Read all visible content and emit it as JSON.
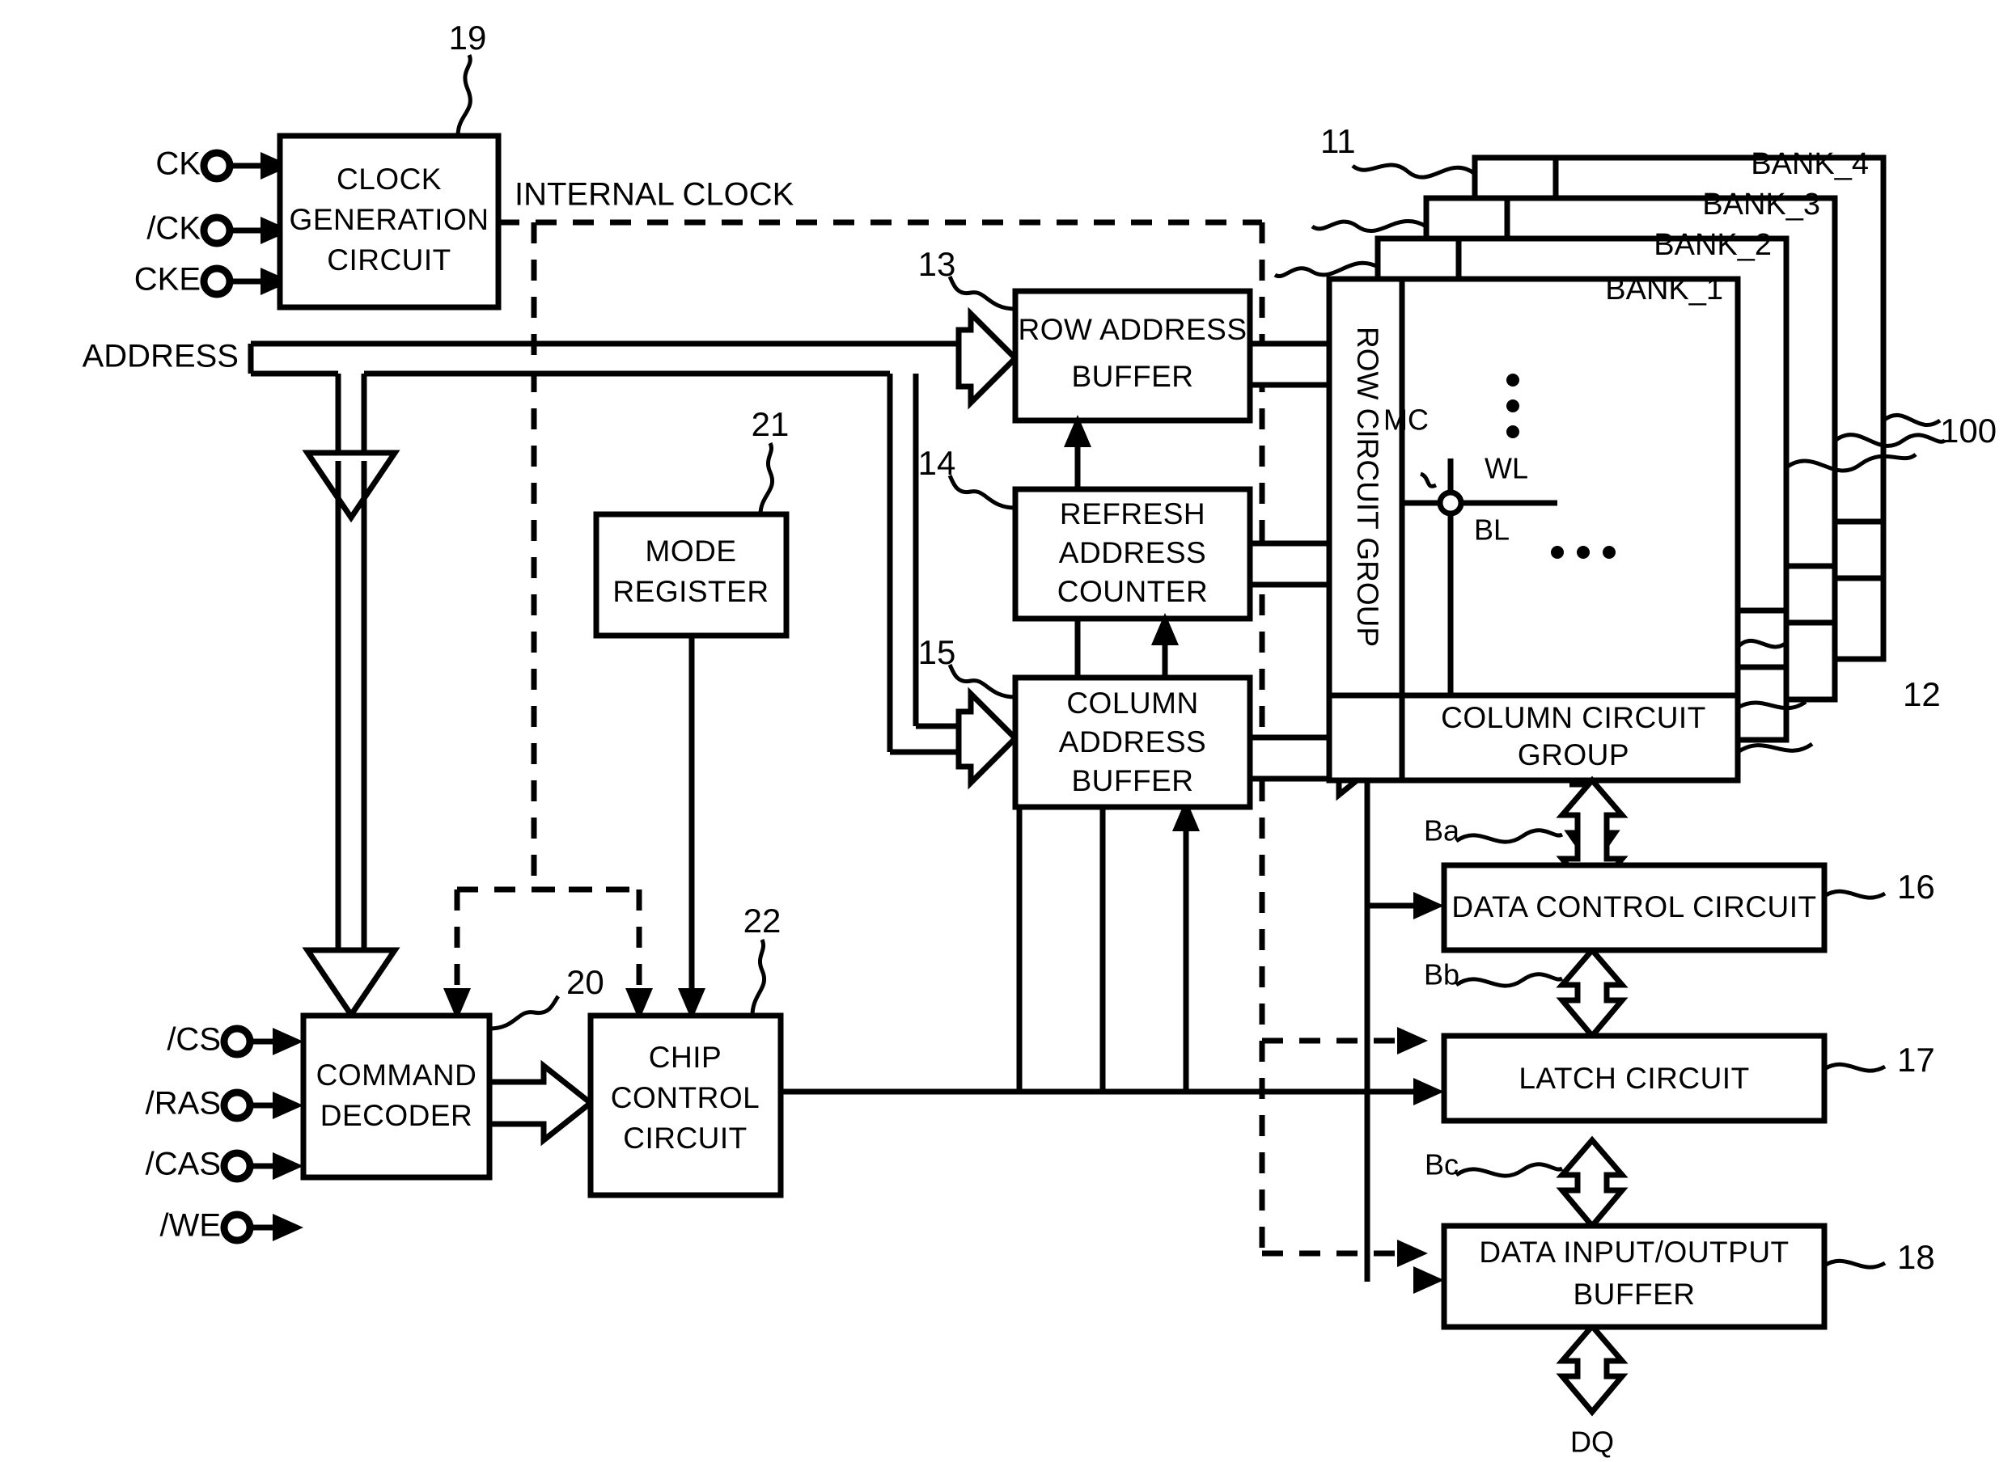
{
  "figure": {
    "type": "semiconductor-block-diagram",
    "title": "SDRAM device block diagram"
  },
  "input_pins": [
    {
      "label": "CK"
    },
    {
      "label": "/CK"
    },
    {
      "label": "CKE"
    },
    {
      "label": "/CS"
    },
    {
      "label": "/RAS"
    },
    {
      "label": "/CAS"
    },
    {
      "label": "/WE"
    }
  ],
  "bus_labels": {
    "address": "ADDRESS",
    "internal_clock": "INTERNAL CLOCK",
    "dq": "DQ"
  },
  "blocks": [
    {
      "id": "clock_gen",
      "label": "CLOCK\nGENERATION\nCIRCUIT",
      "lines": [
        "CLOCK",
        "GENERATION",
        "CIRCUIT"
      ],
      "ref": "19"
    },
    {
      "id": "mode_reg",
      "label": "MODE\nREGISTER",
      "lines": [
        "MODE",
        "REGISTER"
      ],
      "ref": "21"
    },
    {
      "id": "cmd_dec",
      "label": "COMMAND\nDECODER",
      "lines": [
        "COMMAND",
        "DECODER"
      ],
      "ref": "20"
    },
    {
      "id": "chip_ctrl",
      "label": "CHIP\nCONTROL\nCIRCUIT",
      "lines": [
        "CHIP",
        "CONTROL",
        "CIRCUIT"
      ],
      "ref": "22"
    },
    {
      "id": "row_addr",
      "label": "ROW ADDRESS\nBUFFER",
      "lines": [
        "ROW ADDRESS",
        "BUFFER"
      ],
      "ref": "13"
    },
    {
      "id": "refresh_cnt",
      "label": "REFRESH\nADDRESS\nCOUNTER",
      "lines": [
        "REFRESH",
        "ADDRESS",
        "COUNTER"
      ],
      "ref": "14"
    },
    {
      "id": "col_addr",
      "label": "COLUMN\nADDRESS\nBUFFER",
      "lines": [
        "COLUMN",
        "ADDRESS",
        "BUFFER"
      ],
      "ref": "15"
    },
    {
      "id": "row_circuit",
      "label": "ROW CIRCUIT GROUP",
      "lines": [
        "ROW CIRCUIT GROUP"
      ],
      "ref": ""
    },
    {
      "id": "col_circuit",
      "label": "COLUMN CIRCUIT\nGROUP",
      "lines": [
        "COLUMN CIRCUIT",
        "GROUP"
      ],
      "ref": "12"
    },
    {
      "id": "data_ctrl",
      "label": "DATA CONTROL CIRCUIT",
      "lines": [
        "DATA CONTROL CIRCUIT"
      ],
      "ref": "16"
    },
    {
      "id": "latch",
      "label": "LATCH CIRCUIT",
      "lines": [
        "LATCH CIRCUIT"
      ],
      "ref": "17"
    },
    {
      "id": "io_buffer",
      "label": "DATA INPUT/OUTPUT\nBUFFER",
      "lines": [
        "DATA INPUT/OUTPUT",
        "BUFFER"
      ],
      "ref": "18"
    }
  ],
  "banks": [
    {
      "label": "BANK_4"
    },
    {
      "label": "BANK_3"
    },
    {
      "label": "BANK_2"
    },
    {
      "label": "BANK_1"
    }
  ],
  "cell_labels": {
    "memory_cell": "MC",
    "word_line": "WL",
    "bit_line": "BL"
  },
  "bus_tags": [
    {
      "label": "Ba"
    },
    {
      "label": "Bb"
    },
    {
      "label": "Bc"
    }
  ],
  "reference_numerals": [
    {
      "label": "19"
    },
    {
      "label": "13"
    },
    {
      "label": "14"
    },
    {
      "label": "15"
    },
    {
      "label": "21"
    },
    {
      "label": "20"
    },
    {
      "label": "22"
    },
    {
      "label": "11"
    },
    {
      "label": "100"
    },
    {
      "label": "12"
    },
    {
      "label": "16"
    },
    {
      "label": "17"
    },
    {
      "label": "18"
    }
  ],
  "colors": {
    "stroke": "#000000",
    "background": "#ffffff"
  }
}
